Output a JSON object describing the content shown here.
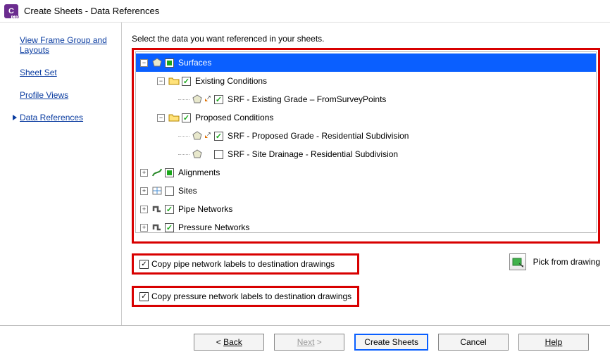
{
  "window": {
    "title": "Create Sheets - Data References"
  },
  "sidebar": {
    "items": [
      {
        "label": "View Frame Group and Layouts",
        "active": false
      },
      {
        "label": "Sheet Set",
        "active": false
      },
      {
        "label": "Profile Views",
        "active": false
      },
      {
        "label": "Data References",
        "active": true
      }
    ]
  },
  "content": {
    "instruction": "Select the data you want referenced in your sheets.",
    "tree": {
      "surfaces": {
        "label": "Surfaces",
        "existing": {
          "label": "Existing Conditions"
        },
        "existing_srf": {
          "label": "SRF - Existing Grade – FromSurveyPoints"
        },
        "proposed": {
          "label": "Proposed Conditions"
        },
        "proposed_srf": {
          "label": "SRF - Proposed Grade - Residential Subdivision"
        },
        "drainage_srf": {
          "label": "SRF - Site Drainage - Residential Subdivision"
        }
      },
      "alignments": {
        "label": "Alignments"
      },
      "sites": {
        "label": "Sites"
      },
      "pipe_networks": {
        "label": "Pipe Networks"
      },
      "pressure_networks": {
        "label": "Pressure Networks"
      }
    },
    "copy_pipe": "Copy pipe network labels to destination drawings",
    "copy_pressure": "Copy pressure network labels to destination drawings",
    "pick": "Pick from drawing"
  },
  "footer": {
    "back": "Back",
    "next": "Next",
    "create": "Create Sheets",
    "cancel": "Cancel",
    "help": "Help"
  }
}
